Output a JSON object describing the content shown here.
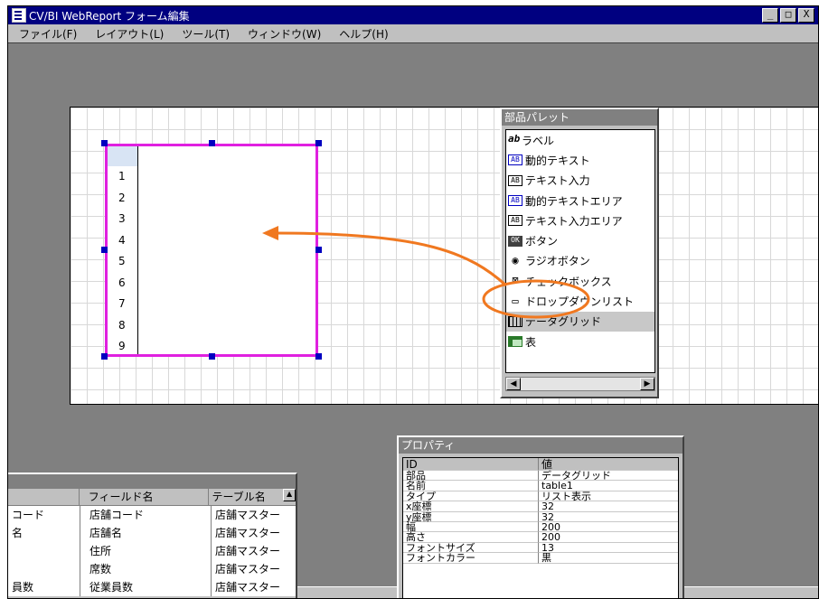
{
  "window": {
    "title": "CV/BI WebReport フォーム編集",
    "buttons": [
      "_",
      "□",
      "X"
    ]
  },
  "menubar": [
    "ファイル(F)",
    "レイアウト(L)",
    "ツール(T)",
    "ウィンドウ(W)",
    "ヘルプ(H)"
  ],
  "datagrid": {
    "row_numbers": [
      "1",
      "2",
      "3",
      "4",
      "5",
      "6",
      "7",
      "8",
      "9"
    ]
  },
  "palette": {
    "title": "部品パレット",
    "items": [
      {
        "label": "ラベル",
        "icon": "ab"
      },
      {
        "label": "動的テキスト",
        "icon": "AB"
      },
      {
        "label": "テキスト入力",
        "icon": "AB"
      },
      {
        "label": "動的テキストエリア",
        "icon": "AB"
      },
      {
        "label": "テキスト入力エリア",
        "icon": "AB"
      },
      {
        "label": "ボタン",
        "icon": "OK"
      },
      {
        "label": "ラジオボタン",
        "icon": "◉"
      },
      {
        "label": "チェックボックス",
        "icon": "⊠"
      },
      {
        "label": "ドロップダウンリスト",
        "icon": "▭"
      },
      {
        "label": "データグリッド",
        "icon": "grid"
      },
      {
        "label": "表",
        "icon": "table"
      }
    ]
  },
  "properties": {
    "title": "プロパティ",
    "header": {
      "key": "ID",
      "value": "値"
    },
    "rows": [
      {
        "k": "部品",
        "v": "データグリッド"
      },
      {
        "k": "名前",
        "v": "table1"
      },
      {
        "k": "タイプ",
        "v": "リスト表示"
      },
      {
        "k": "x座標",
        "v": "32"
      },
      {
        "k": "y座標",
        "v": "32"
      },
      {
        "k": "幅",
        "v": "200"
      },
      {
        "k": "高さ",
        "v": "200"
      },
      {
        "k": "フォントサイズ",
        "v": "13"
      },
      {
        "k": "フォントカラー",
        "v": "黒"
      }
    ]
  },
  "fields": {
    "headers": [
      "",
      "フィールド名",
      "テーブル名"
    ],
    "rows": [
      [
        "コード",
        "店舗コード",
        "店舗マスター"
      ],
      [
        "名",
        "店舗名",
        "店舗マスター"
      ],
      [
        "",
        "住所",
        "店舗マスター"
      ],
      [
        "",
        "席数",
        "店舗マスター"
      ],
      [
        "員数",
        "従業員数",
        "店舗マスター"
      ]
    ]
  },
  "colors": {
    "titlebar": "#000080",
    "selection_border": "#e020e0",
    "annotation": "#f07820",
    "handle": "#0000c0"
  }
}
